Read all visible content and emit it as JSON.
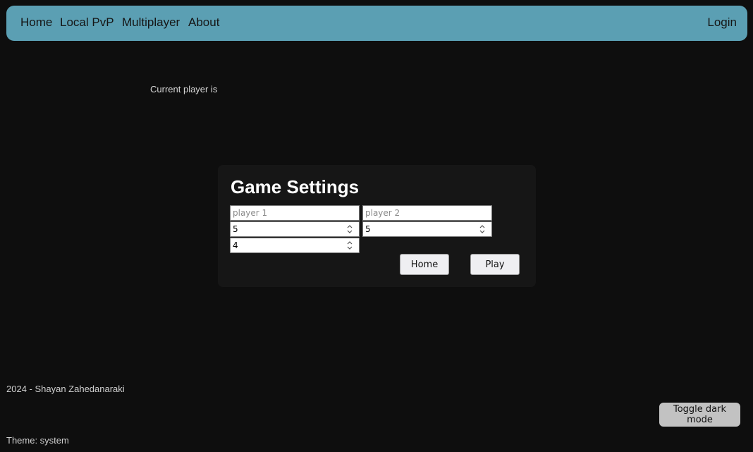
{
  "nav": {
    "items": [
      {
        "label": "Home"
      },
      {
        "label": "Local PvP"
      },
      {
        "label": "Multiplayer"
      },
      {
        "label": "About"
      }
    ],
    "login": "Login",
    "background_color": "#5b9fb3"
  },
  "status": {
    "current_player": "Current player is"
  },
  "settings": {
    "title": "Game Settings",
    "player1": {
      "placeholder": "player 1",
      "value": ""
    },
    "player2": {
      "placeholder": "player 2",
      "value": ""
    },
    "number1": {
      "value": "5"
    },
    "number2": {
      "value": "5"
    },
    "number3": {
      "value": "4"
    },
    "home_button": "Home",
    "play_button": "Play"
  },
  "footer": {
    "credit": "2024 - Shayan Zahedanaraki",
    "theme": "Theme: system",
    "toggle_button": "Toggle dark mode"
  },
  "colors": {
    "page_background": "#0e0e0e",
    "dialog_background": "#161616"
  }
}
